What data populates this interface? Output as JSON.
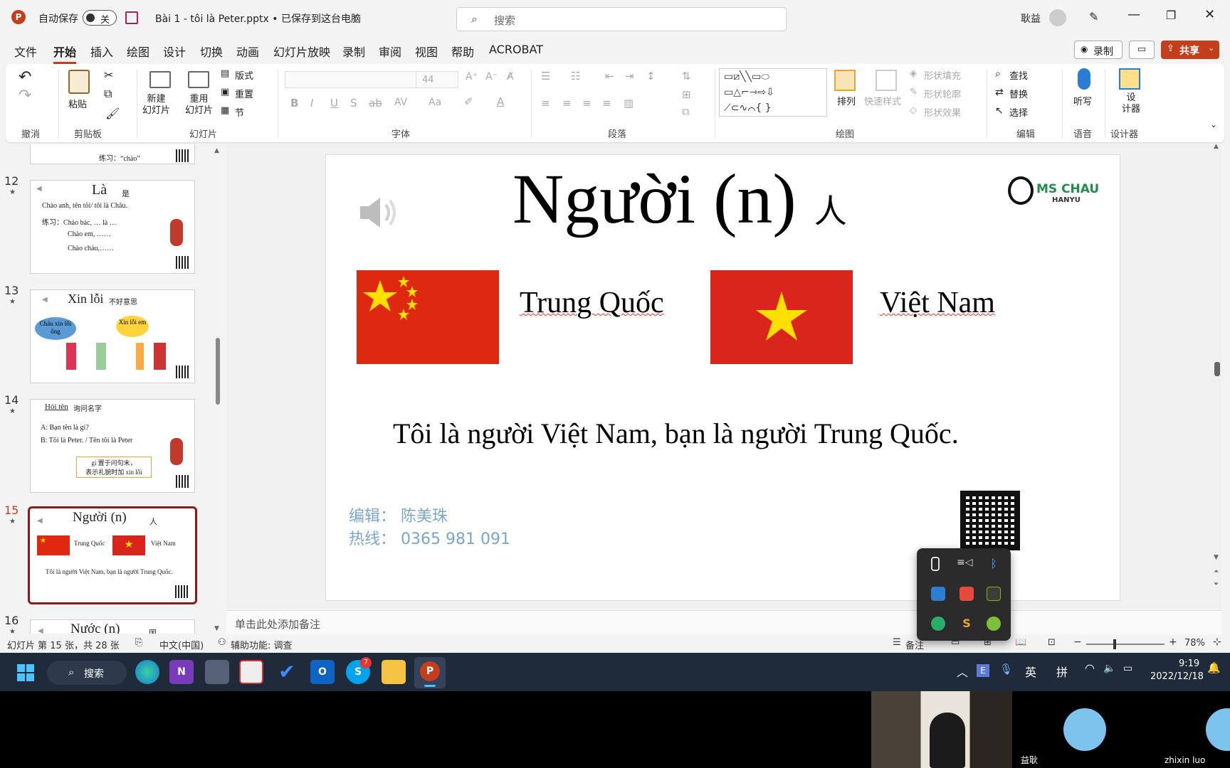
{
  "titlebar": {
    "autosave_label": "自动保存",
    "autosave_toggle": "关",
    "doc_title": "Bài 1 - tôi là Peter.pptx • 已保存到这台电脑",
    "search_placeholder": "搜索",
    "user_name": "耿益"
  },
  "menu": {
    "tabs": [
      "文件",
      "开始",
      "插入",
      "绘图",
      "设计",
      "切换",
      "动画",
      "幻灯片放映",
      "录制",
      "审阅",
      "视图",
      "帮助",
      "ACROBAT"
    ],
    "record_label": "录制",
    "share_label": "共享"
  },
  "ribbon": {
    "groups": [
      "撤消",
      "剪贴板",
      "幻灯片",
      "字体",
      "段落",
      "绘图",
      "编辑",
      "语音",
      "设计器"
    ],
    "paste": "粘贴",
    "new_slide": "新建\n幻灯片",
    "reuse_slide": "重用\n幻灯片",
    "layout": "版式",
    "reset": "重置",
    "section": "节",
    "font_size": "44",
    "arrange": "排列",
    "quick_styles": "快速样式",
    "shape_fill": "形状填充",
    "shape_outline": "形状轮廓",
    "shape_effects": "形状效果",
    "find": "查找",
    "replace": "替换",
    "select": "选择",
    "dictate": "听写",
    "designer": "设\n计器"
  },
  "thumbnails": [
    {
      "num": "12",
      "title": "Là",
      "title_cn": "是",
      "lines": [
        "Chào anh, tên tôi/ tôi là Châu.",
        "练习：Chào bác, … là …",
        "Chào em, ……",
        "Chào cháu,……"
      ]
    },
    {
      "num": "13",
      "title": "Xin lỗi",
      "title_cn": "不好意思",
      "bubble1": "Cháu xin lỗi ông",
      "bubble2": "Xin lỗi em"
    },
    {
      "num": "14",
      "title": "Hỏi tên",
      "title_cn": "询问名字",
      "lines": [
        "A: Bạn tên là gì?",
        "B: Tôi là Peter.  / Tên tôi là Peter"
      ],
      "note1": "gì 置于问句末，",
      "note2": "表示礼貌时加 xin lỗi"
    },
    {
      "num": "15",
      "title": "Người  (n)",
      "title_cn": "人",
      "label1": "Trung Quốc",
      "label2": "Việt Nam",
      "sentence": "Tôi là người Việt Nam, bạn là người Trung Quốc."
    },
    {
      "num": "16",
      "title": "Nước  (n)",
      "title_cn": "国"
    }
  ],
  "thumb_top_snippet": "练习：“chào”",
  "slide": {
    "title": "Người  (n)",
    "title_cn": "人",
    "logo_text": "MS CHAU",
    "logo_sub": "HANYU",
    "label_china": "Trung Quốc",
    "label_vietnam": "Việt Nam",
    "sentence": "Tôi là người Việt Nam, bạn là người Trung Quốc.",
    "editor": "编辑：  陈美珠",
    "hotline": "热线：  0365  981  091"
  },
  "notes_placeholder": "单击此处添加备注",
  "status": {
    "slide_info": "幻灯片 第 15 张，共 28 张",
    "language": "中文(中国)",
    "accessibility": "辅助功能: 调查",
    "notes": "备注",
    "zoom": "78%"
  },
  "taskbar": {
    "search": "搜索",
    "skype_badge": "7",
    "ime1": "英",
    "ime2": "拼",
    "time": "9:19",
    "date": "2022/12/18"
  },
  "video": {
    "participant1": "益耿",
    "participant2": "zhixin luo"
  },
  "colors": {
    "accent": "#c43e1c",
    "taskbar": "#1f2a3a",
    "flag_red": "#de2910",
    "star_yellow": "#ffde00"
  }
}
